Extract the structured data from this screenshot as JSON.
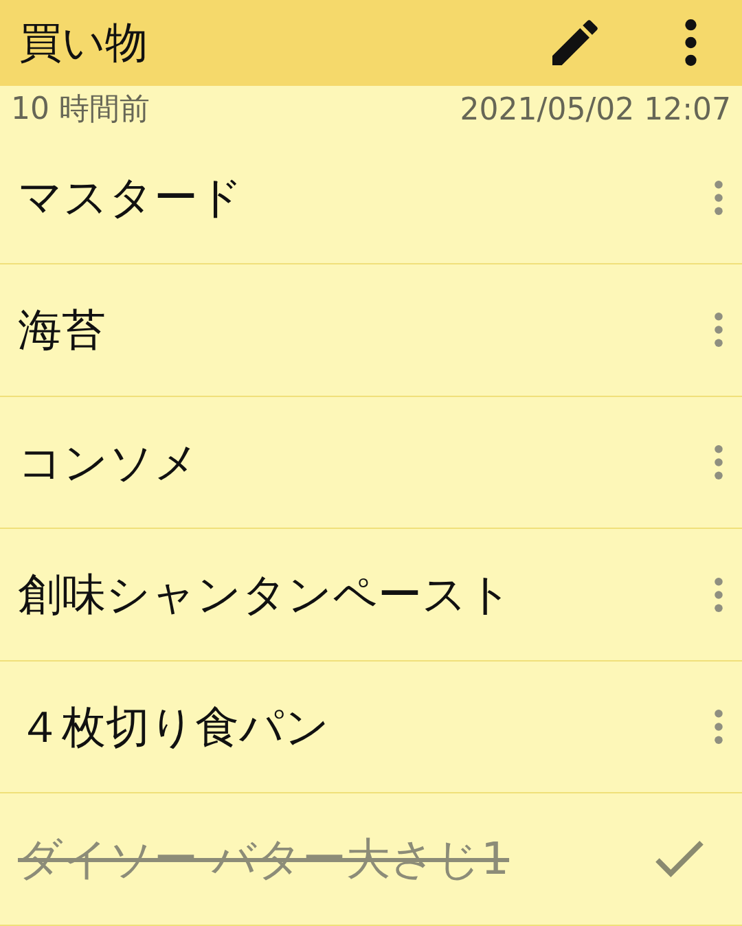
{
  "title": "買い物",
  "meta": {
    "relative_time": "10 時間前",
    "timestamp": "2021/05/02 12:07"
  },
  "items": [
    {
      "text": "マスタード",
      "checked": false
    },
    {
      "text": "海苔",
      "checked": false
    },
    {
      "text": "コンソメ",
      "checked": false
    },
    {
      "text": "創味シャンタンペースト",
      "checked": false
    },
    {
      "text": "４枚切り食パン",
      "checked": false
    },
    {
      "text": "ダイソー バター大さじ1",
      "checked": true
    }
  ]
}
